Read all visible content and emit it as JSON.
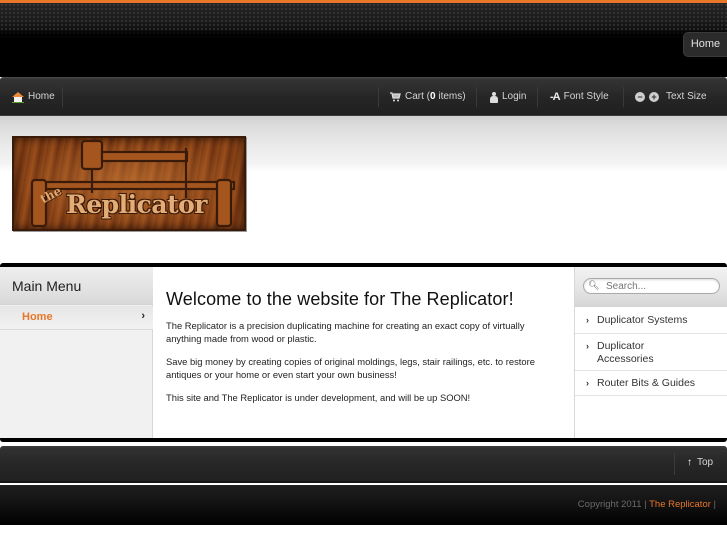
{
  "colors": {
    "accent": "#e8772a",
    "header_bg": "#000000",
    "navbar_bg": "#2a2a2a",
    "left_col_bg": "#f1f1f1"
  },
  "top_header": {
    "home_button": "Home"
  },
  "navbar": {
    "home": {
      "label": "Home",
      "icon": "home-icon"
    },
    "cart": {
      "prefix": "Cart (",
      "count": "0",
      "suffix": " items)",
      "icon": "cart-icon"
    },
    "login": {
      "label": "Login",
      "icon": "user-icon"
    },
    "font_style": {
      "label": "Font Style",
      "icon_text": "-A",
      "icon": "font-icon"
    },
    "text_size": {
      "label": "Text Size",
      "decrease_icon": "−",
      "increase_icon": "+"
    }
  },
  "logo": {
    "the": "the",
    "name": "Replicator",
    "alt": "The Replicator"
  },
  "left_menu": {
    "title": "Main Menu",
    "items": [
      {
        "label": "Home",
        "chevron": "›",
        "active": true
      }
    ]
  },
  "main": {
    "title": "Welcome to the website for The Replicator!",
    "paragraphs": [
      "The Replicator is a precision duplicating machine for creating an exact copy of virtually anything made from wood or plastic.",
      "Save big money by creating copies of original moldings, legs, stair railings, etc. to restore antiques or your home or even start your own business!",
      "This site and The Replicator is under development, and will be up SOON!"
    ]
  },
  "right_menu": {
    "search": {
      "placeholder": "Search...",
      "value": ""
    },
    "items": [
      {
        "label": "Duplicator Systems",
        "chevron": "›"
      },
      {
        "label": "Duplicator Accessories",
        "chevron": "›"
      },
      {
        "label": "Router Bits & Guides",
        "chevron": "›"
      }
    ]
  },
  "bottom_bar": {
    "top_link": "Top",
    "top_icon": "↑"
  },
  "footer": {
    "copyright_prefix": "Copyright  2011 | ",
    "site_link": "The Replicator",
    "suffix": " |"
  }
}
